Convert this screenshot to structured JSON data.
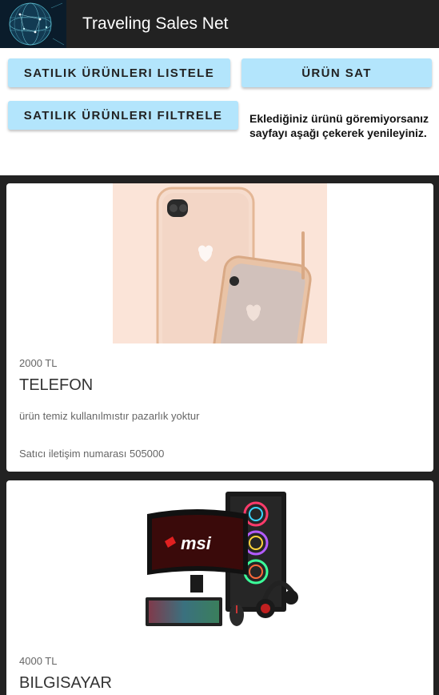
{
  "header": {
    "title": "Traveling Sales Net",
    "logo_icon": "globe-network-icon"
  },
  "actions": {
    "list_label": "SATILIK ÜRÜNLERI LISTELE",
    "sell_label": "ÜRÜN SAT",
    "filter_label": "SATILIK ÜRÜNLERI FILTRELE",
    "note": "Eklediğiniz ürünü göremiyorsanız sayfayı aşağı çekerek yenileyiniz."
  },
  "colors": {
    "header_bg": "#222222",
    "button_bg": "#b3e5fc",
    "feed_bg": "#222222"
  },
  "products": [
    {
      "price": "2000 TL",
      "title": "TELEFON",
      "description": "ürün temiz kullanılmıstır pazarlık yoktur",
      "contact": "Satıcı iletişim numarası 505000",
      "image_icon": "smartphone-image"
    },
    {
      "price": "4000 TL",
      "title": "BILGISAYAR",
      "image_icon": "gaming-pc-image",
      "image_brand": "msi"
    }
  ]
}
